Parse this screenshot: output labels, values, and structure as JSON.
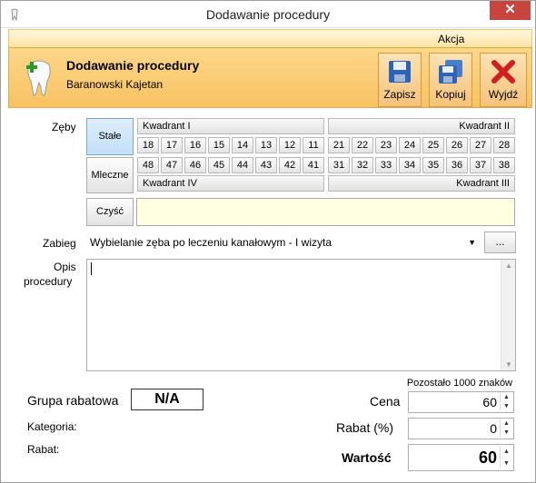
{
  "window": {
    "title": "Dodawanie procedury",
    "close_label": "✕"
  },
  "ribbon": {
    "tab_label": "Akcja",
    "title": "Dodawanie procedury",
    "subtitle": "Baranowski Kajetan",
    "buttons": {
      "save": "Zapisz",
      "copy": "Kopiuj",
      "exit": "Wyjdź"
    }
  },
  "teeth": {
    "label": "Zęby",
    "permanent_button": "Stałe",
    "milk_button": "Mleczne",
    "clear_button": "Czyść",
    "quadrants": {
      "q1": "Kwadrant I",
      "q2": "Kwadrant II",
      "q3": "Kwadrant III",
      "q4": "Kwadrant IV"
    },
    "row_upper_left": [
      "18",
      "17",
      "16",
      "15",
      "14",
      "13",
      "12",
      "11"
    ],
    "row_upper_right": [
      "21",
      "22",
      "23",
      "24",
      "25",
      "26",
      "27",
      "28"
    ],
    "row_lower_left": [
      "48",
      "47",
      "46",
      "45",
      "44",
      "43",
      "42",
      "41"
    ],
    "row_lower_right": [
      "31",
      "32",
      "33",
      "34",
      "35",
      "36",
      "37",
      "38"
    ]
  },
  "procedure": {
    "label": "Zabieg",
    "selected": "Wybielanie zęba po leczeniu kanałowym - I wizyta",
    "browse_label": "..."
  },
  "description": {
    "label_line1": "Opis",
    "label_line2": "procedury",
    "value": "",
    "counter": "Pozostało 1000 znaków"
  },
  "discount_group": {
    "label": "Grupa rabatowa",
    "value": "N/A",
    "category_label": "Kategoria:",
    "discount_label": "Rabat:"
  },
  "pricing": {
    "price_label": "Cena",
    "price": "60",
    "discount_pct_label": "Rabat (%)",
    "discount_pct": "0",
    "value_label": "Wartość",
    "value": "60"
  }
}
